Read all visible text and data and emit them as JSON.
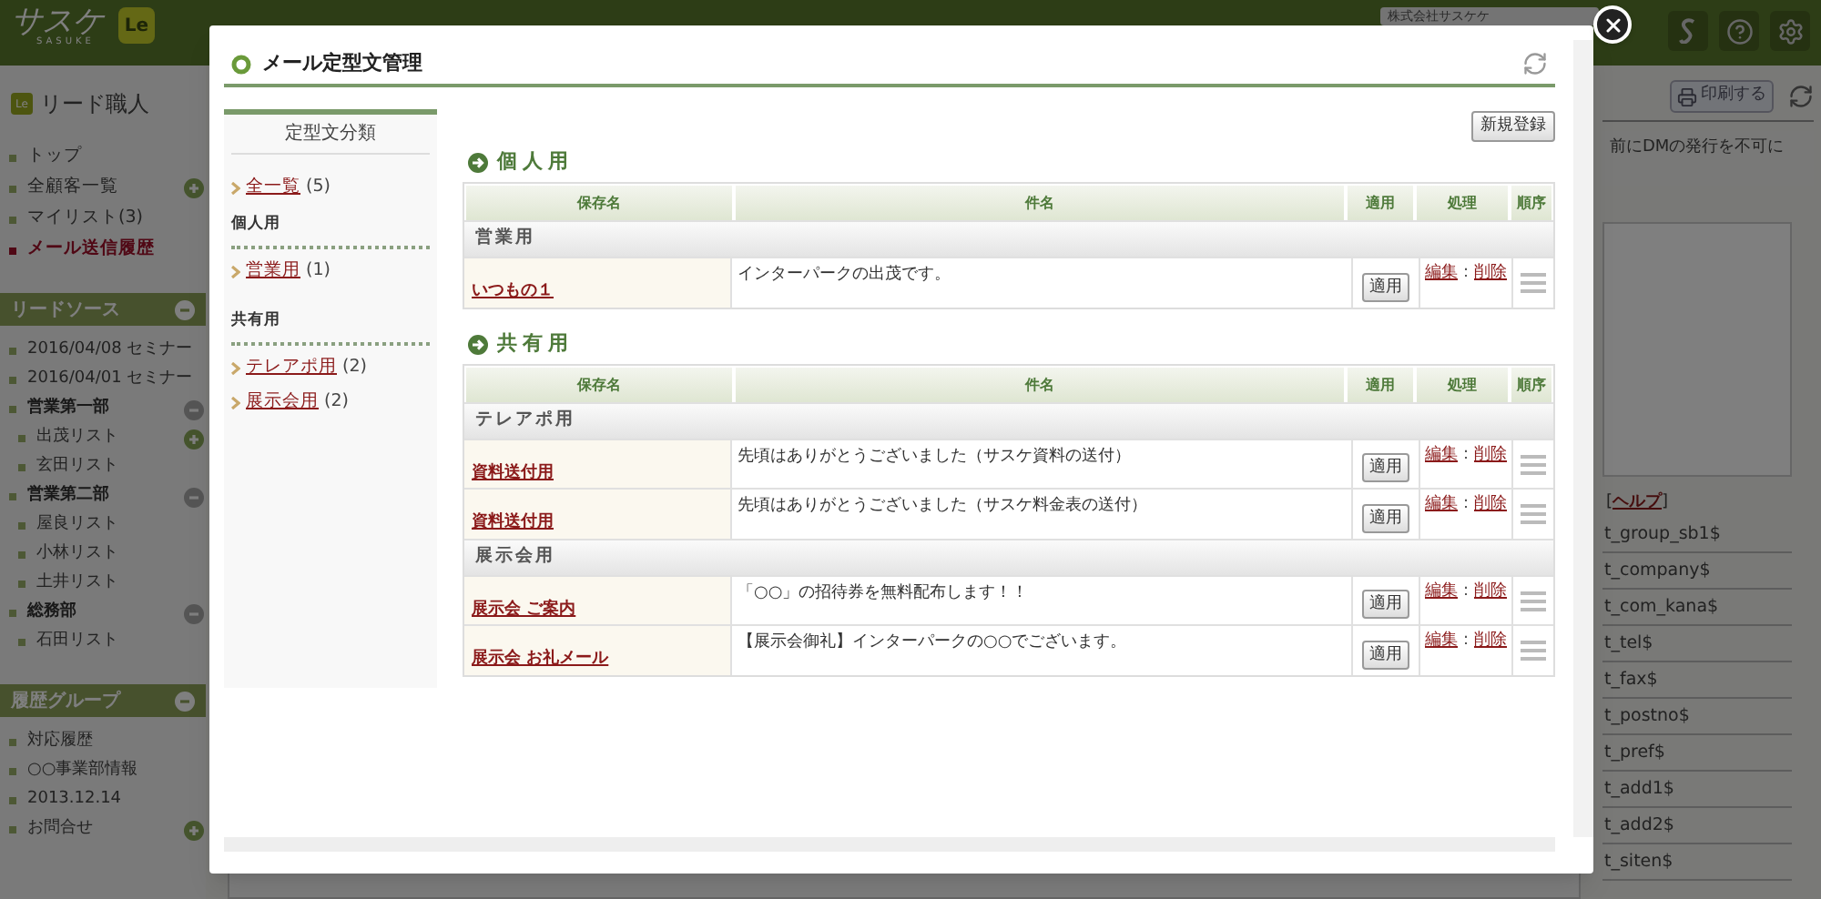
{
  "header": {
    "logo": "サスケ",
    "logo_sub": "SASUKE",
    "app_badge": "Le",
    "company": "株式会社サスケケ"
  },
  "sidebar": {
    "app_badge": "Le",
    "app_title": "リード職人",
    "nav": [
      {
        "label": "トップ",
        "selected": false,
        "kind": "plain"
      },
      {
        "label": "全顧客一覧",
        "selected": false,
        "kind": "expandable"
      },
      {
        "label": "マイリスト(3)",
        "selected": false,
        "kind": "plain"
      },
      {
        "label": "メール送信履歴",
        "selected": true,
        "kind": "plain"
      }
    ],
    "sections": [
      {
        "title": "リードソース",
        "items": [
          {
            "label": "2016/04/08 セミナー",
            "kind": "plain"
          },
          {
            "label": "2016/04/01 セミナー",
            "kind": "plain"
          },
          {
            "label": "営業第一部",
            "kind": "collapsible",
            "children": [
              {
                "label": "出茂リスト",
                "kind": "expandable"
              },
              {
                "label": "玄田リスト",
                "kind": "plain"
              }
            ]
          },
          {
            "label": "営業第二部",
            "kind": "collapsible",
            "children": [
              {
                "label": "屋良リスト",
                "kind": "plain"
              },
              {
                "label": "小林リスト",
                "kind": "plain"
              },
              {
                "label": "土井リスト",
                "kind": "plain"
              }
            ]
          },
          {
            "label": "総務部",
            "kind": "collapsible",
            "children": [
              {
                "label": "石田リスト",
                "kind": "plain"
              }
            ]
          }
        ]
      },
      {
        "title": "履歴グループ",
        "items": [
          {
            "label": "対応履歴",
            "kind": "plain"
          },
          {
            "label": "○○事業部情報",
            "kind": "plain"
          },
          {
            "label": "2013.12.14",
            "kind": "plain"
          },
          {
            "label": "お問合せ",
            "kind": "expandable"
          }
        ]
      }
    ]
  },
  "main": {
    "print_button": "印刷する",
    "notice": "前にDMの発行を不可に",
    "help_open": "[",
    "help_link": "ヘルプ",
    "help_close": "]",
    "variables": [
      "t_group_sb1$",
      "t_company$",
      "t_com_kana$",
      "t_tel$",
      "t_fax$",
      "t_postno$",
      "t_pref$",
      "t_add1$",
      "t_add2$",
      "t_siten$"
    ]
  },
  "modal": {
    "title": "メール定型文管理",
    "category_panel": {
      "title": "定型文分類",
      "all": {
        "label": "全一覧",
        "count": "(5)"
      },
      "groups": [
        {
          "title": "個人用",
          "items": [
            {
              "label": "営業用",
              "count": "(1)"
            }
          ]
        },
        {
          "title": "共有用",
          "items": [
            {
              "label": "テレアポ用",
              "count": "(2)"
            },
            {
              "label": "展示会用",
              "count": "(2)"
            }
          ]
        }
      ]
    },
    "new_button": "新規登録",
    "sections": [
      {
        "title": "個人用",
        "columns": [
          "保存名",
          "件名",
          "適用",
          "処理",
          "順序"
        ],
        "groups": [
          {
            "title": "営業用",
            "rows": [
              {
                "name": "いつもの１",
                "subject": "インターパークの出茂です。",
                "apply": "適用",
                "edit": "編集",
                "separator": "：",
                "delete": "削除"
              }
            ]
          }
        ]
      },
      {
        "title": "共有用",
        "columns": [
          "保存名",
          "件名",
          "適用",
          "処理",
          "順序"
        ],
        "groups": [
          {
            "title": "テレアポ用",
            "rows": [
              {
                "name": "資料送付用",
                "subject": "先頃はありがとうございました（サスケ資料の送付）",
                "apply": "適用",
                "edit": "編集",
                "separator": "：",
                "delete": "削除"
              },
              {
                "name": "資料送付用",
                "subject": "先頃はありがとうございました（サスケ料金表の送付）",
                "apply": "適用",
                "edit": "編集",
                "separator": "：",
                "delete": "削除"
              }
            ]
          },
          {
            "title": "展示会用",
            "rows": [
              {
                "name": "展示会 ご案内",
                "subject": "「○○」の招待券を無料配布します！！",
                "apply": "適用",
                "edit": "編集",
                "separator": "：",
                "delete": "削除"
              },
              {
                "name": "展示会 お礼メール",
                "subject": "【展示会御礼】インターパークの○○でございます。",
                "apply": "適用",
                "edit": "編集",
                "separator": "：",
                "delete": "削除"
              }
            ]
          }
        ]
      }
    ]
  }
}
